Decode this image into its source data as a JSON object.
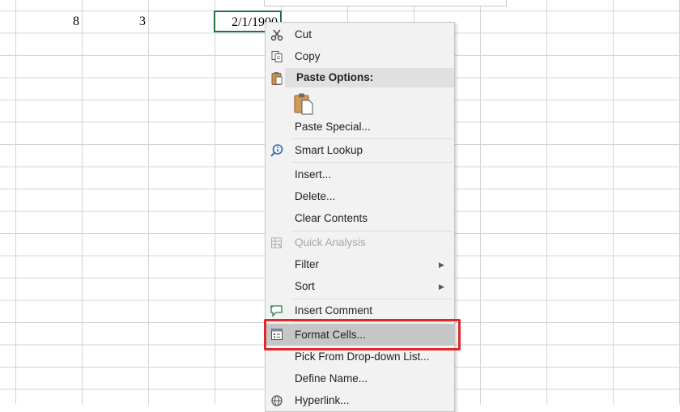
{
  "sheet": {
    "cells": [
      "8",
      "3",
      "2/1/1900"
    ]
  },
  "context_menu": {
    "cut": "Cut",
    "copy": "Copy",
    "paste_options": "Paste Options:",
    "paste_special": "Paste Special...",
    "smart_lookup": "Smart Lookup",
    "insert": "Insert...",
    "delete": "Delete...",
    "clear_contents": "Clear Contents",
    "quick_analysis": "Quick Analysis",
    "filter": "Filter",
    "sort": "Sort",
    "insert_comment": "Insert Comment",
    "format_cells": "Format Cells...",
    "pick_list": "Pick From Drop-down List...",
    "define_name": "Define Name...",
    "hyperlink": "Hyperlink..."
  },
  "colors": {
    "active_cell_border": "#217346",
    "highlight_box": "#e0282a",
    "hover_row": "#c6c6c6"
  }
}
